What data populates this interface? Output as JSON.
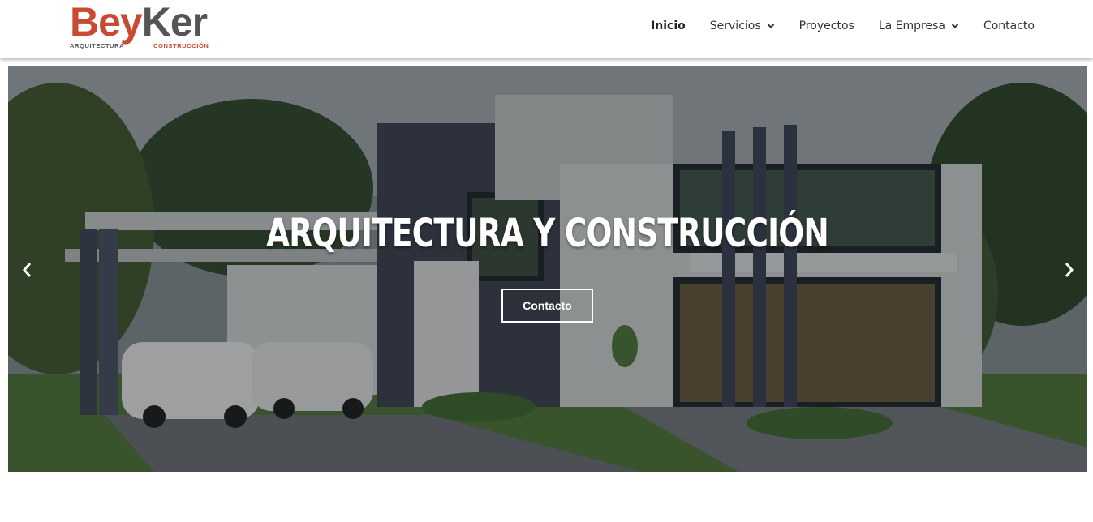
{
  "brand": {
    "name_part1": "Bey",
    "name_part2": "Ker",
    "sub_left": "ARQUITECTURA",
    "sub_right": "CONSTRUCCIÓN",
    "color_primary": "#c94a33",
    "color_secondary": "#555558"
  },
  "nav": {
    "items": [
      {
        "label": "Inicio",
        "active": true,
        "dropdown": false
      },
      {
        "label": "Servicios",
        "active": false,
        "dropdown": true
      },
      {
        "label": "Proyectos",
        "active": false,
        "dropdown": false
      },
      {
        "label": "La Empresa",
        "active": false,
        "dropdown": true
      },
      {
        "label": "Contacto",
        "active": false,
        "dropdown": false
      }
    ]
  },
  "hero": {
    "title": "ARQUITECTURA Y CONSTRUCCIÓN",
    "button_label": "Contacto",
    "prev_icon": "chevron-left-icon",
    "next_icon": "chevron-right-icon",
    "image": "modern-house-render"
  }
}
